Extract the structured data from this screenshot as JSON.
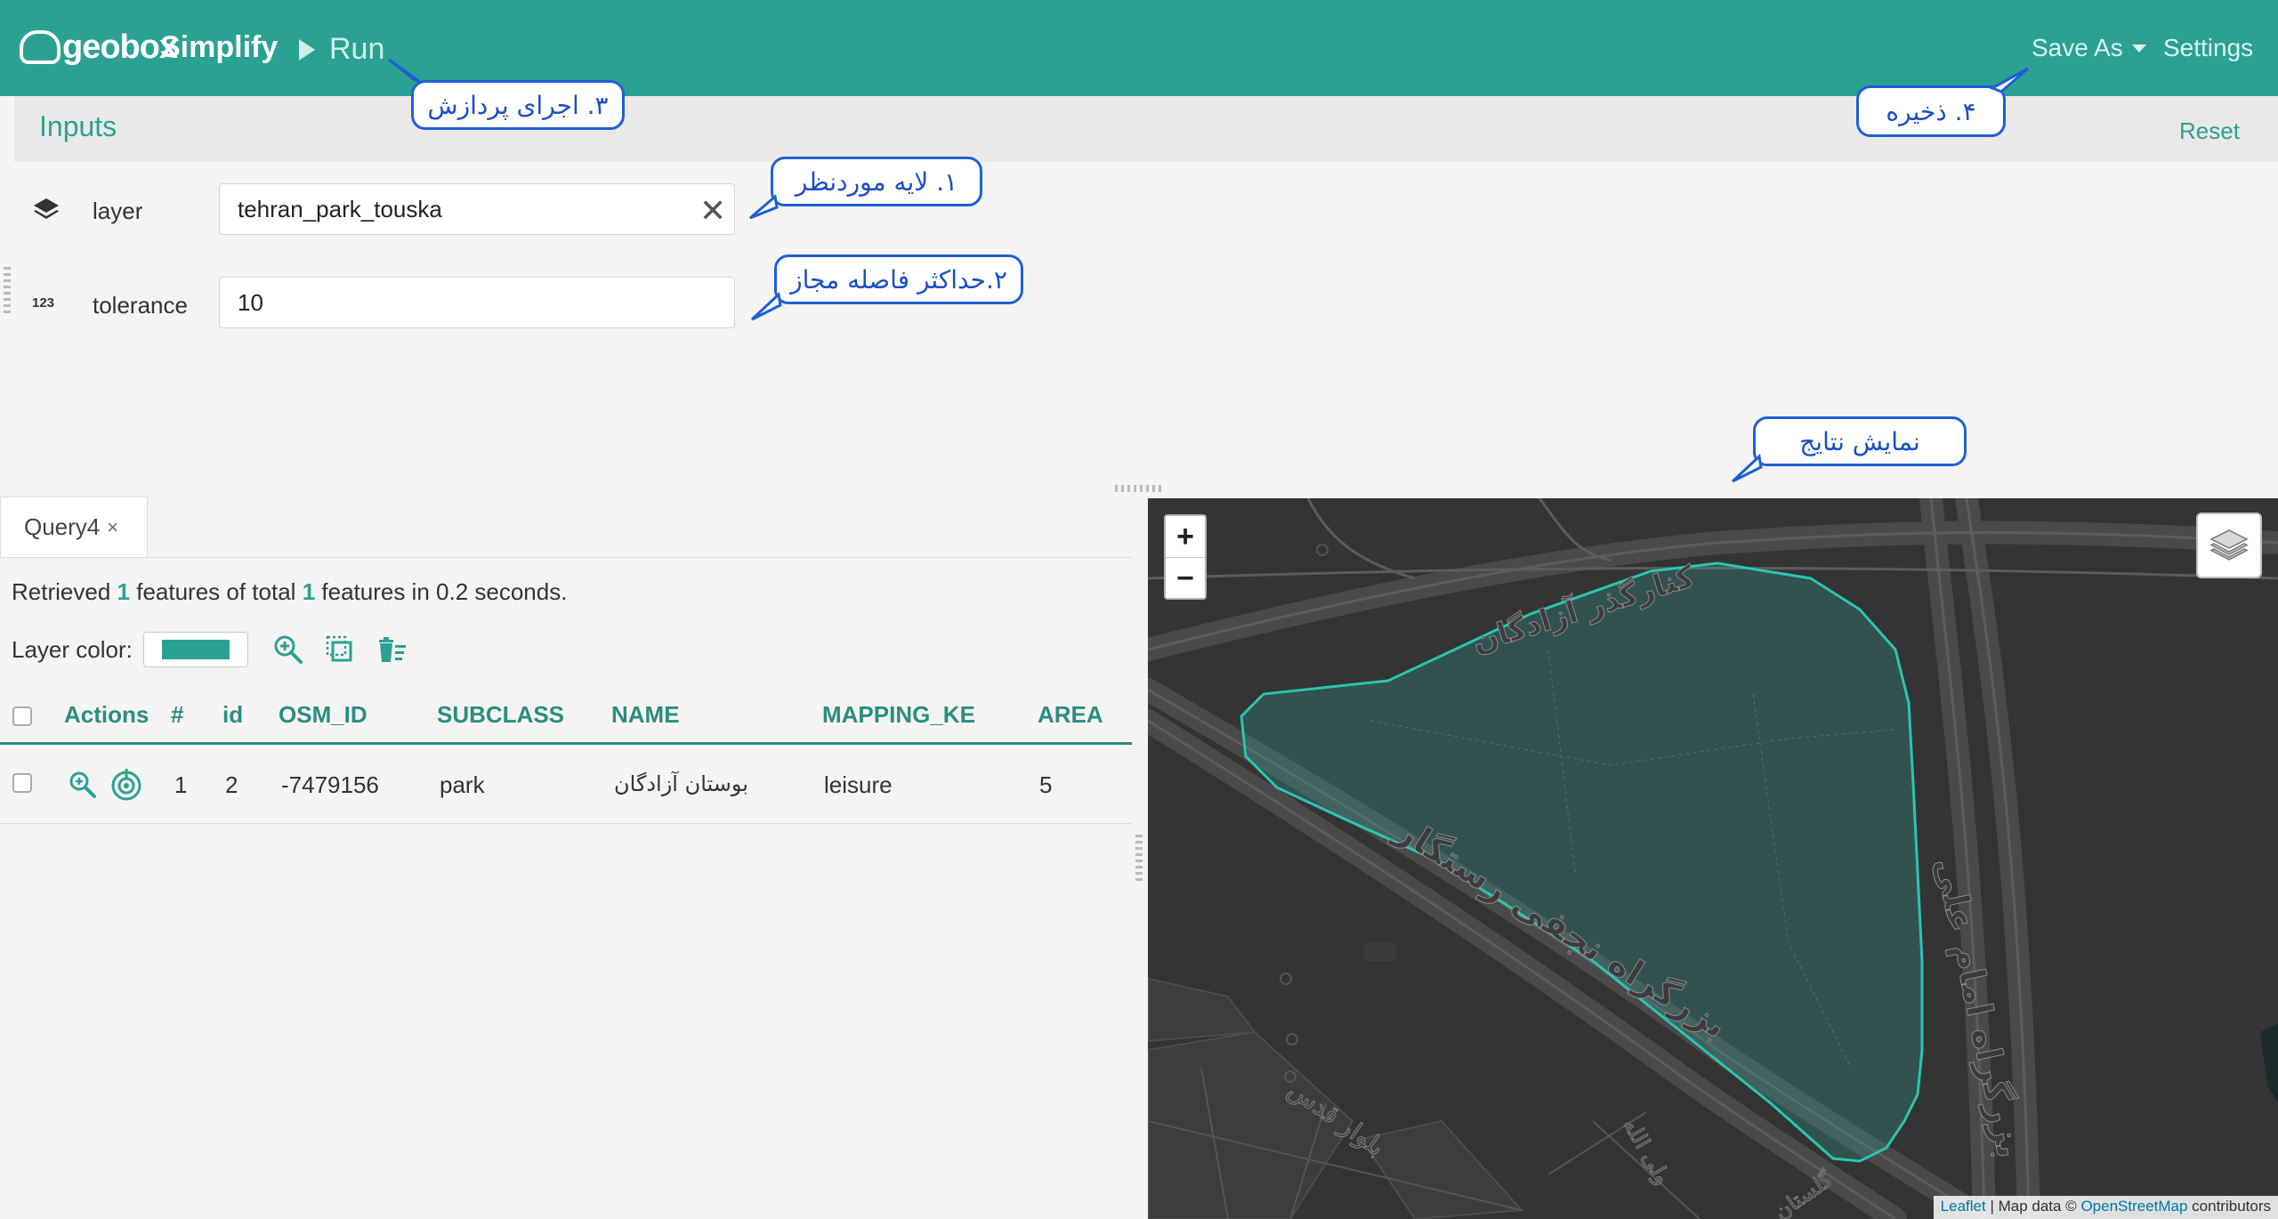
{
  "header": {
    "logo_text": "geobox",
    "title": "Simplify",
    "run_label": "Run",
    "save_as_label": "Save As",
    "settings_label": "Settings"
  },
  "inputs": {
    "title": "Inputs",
    "reset_label": "Reset",
    "layer": {
      "label": "layer",
      "value": "tehran_park_touska"
    },
    "tolerance": {
      "label": "tolerance",
      "value": "10",
      "icon_text": "123"
    }
  },
  "callouts": {
    "run": "۳. اجرای پردازش",
    "save": "۴. ذخیره",
    "layer": "۱. لایه موردنظر",
    "tolerance": "۲.حداکثر فاصله مجاز",
    "results": "نمایش نتایج"
  },
  "results": {
    "tab_label": "Query4",
    "tab_close": "×",
    "summary": {
      "pre": "Retrieved",
      "retrieved": "1",
      "mid": "features of total",
      "total": "1",
      "post": "features in 0.2 seconds."
    },
    "layer_color_label": "Layer color:",
    "columns": [
      "Actions",
      "#",
      "id",
      "OSM_ID",
      "SUBCLASS",
      "NAME",
      "MAPPING_KE",
      "AREA"
    ],
    "rows": [
      {
        "num": "1",
        "id": "2",
        "osm_id": "-7479156",
        "subclass": "park",
        "name": "بوستان آزادگان",
        "mapping_ke": "leisure",
        "area": "5"
      }
    ]
  },
  "map": {
    "zoom_in": "+",
    "zoom_out": "−",
    "labels": {
      "road_top": "کنارگذر آزادگان",
      "road_diag": "بزرگراه نجفی رستگار",
      "road_right": "بزرگراه امام علی",
      "street1": "بلوار قدس",
      "street2": "ولی الله",
      "street3": "گلستان"
    },
    "attribution": {
      "leaflet": "Leaflet",
      "sep": " | Map data © ",
      "osm": "OpenStreetMap",
      "tail": " contributors"
    },
    "polygon_color": "#2aa193"
  },
  "colors": {
    "accent": "#2aa193",
    "header_bg": "#2aa193",
    "callout_border": "#1e5fd9",
    "map_bg": "#343434"
  }
}
